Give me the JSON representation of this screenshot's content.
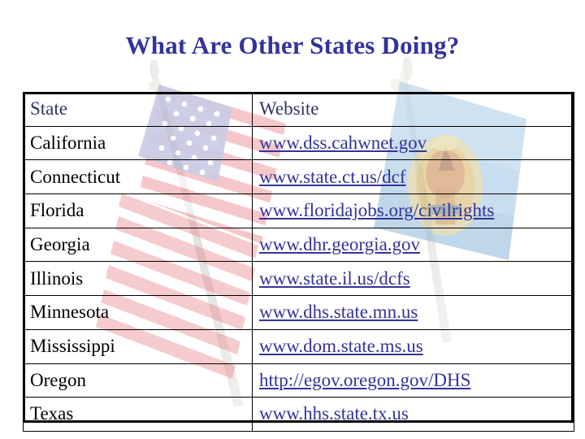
{
  "slide": {
    "title": "What Are Other States Doing?",
    "title_color": "#333399",
    "background_color": "#ffffff",
    "link_color": "#333399",
    "header_color": "#333366",
    "body_text_color": "#000000",
    "border_color": "#000000",
    "background_art": [
      "american-flag-on-pole",
      "state-flag-blue-with-gold-seal-on-pole"
    ]
  },
  "table": {
    "columns": [
      {
        "key": "state",
        "label": "State"
      },
      {
        "key": "website",
        "label": "Website"
      }
    ],
    "rows": [
      {
        "state": "California",
        "website": "www.dss.cahwnet.gov"
      },
      {
        "state": "Connecticut",
        "website": "www.state.ct.us/dcf"
      },
      {
        "state": "Florida",
        "website": "www.floridajobs.org/civilrights"
      },
      {
        "state": "Georgia",
        "website": "www.dhr.georgia.gov"
      },
      {
        "state": "Illinois",
        "website": "www.state.il.us/dcfs"
      },
      {
        "state": "Minnesota",
        "website": "www.dhs.state.mn.us"
      },
      {
        "state": "Mississippi",
        "website": "www.dom.state.ms.us"
      },
      {
        "state": "Oregon",
        "website": "http://egov.oregon.gov/DHS"
      },
      {
        "state": "Texas",
        "website": "www.hhs.state.tx.us"
      }
    ]
  }
}
